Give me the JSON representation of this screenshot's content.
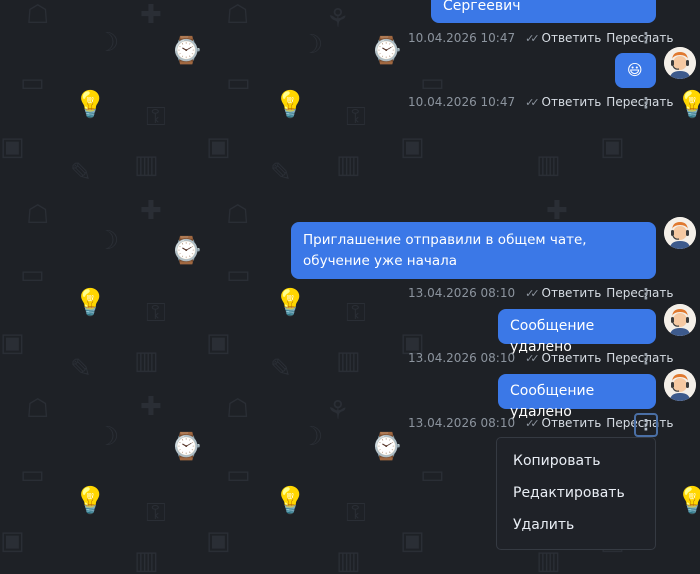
{
  "messages": [
    {
      "text": "Сергеевич",
      "time": "10.04.2026 10:47",
      "reply": "Ответить",
      "forward": "Переслать"
    },
    {
      "text": "😃",
      "time": "10.04.2026 10:47",
      "reply": "Ответить",
      "forward": "Переслать"
    },
    {
      "text": "Приглашение отправили в общем чате, обучение уже начала",
      "time": "13.04.2026 08:10",
      "reply": "Ответить",
      "forward": "Переслать"
    },
    {
      "text": "Сообщение удалено",
      "time": "13.04.2026 08:10",
      "reply": "Ответить",
      "forward": "Переслать"
    },
    {
      "text": "Сообщение удалено",
      "time": "13.04.2026 08:10",
      "reply": "Ответить",
      "forward": "Переслать"
    }
  ],
  "context_menu": {
    "items": [
      "Копировать",
      "Редактировать",
      "Удалить"
    ]
  },
  "icons": {
    "read_status": "double-check-icon",
    "more": "kebab-icon",
    "avatar": "support-operator-avatar"
  },
  "colors": {
    "background": "#1e2126",
    "bubble": "#3b78e7",
    "menu": "#1f2228"
  }
}
